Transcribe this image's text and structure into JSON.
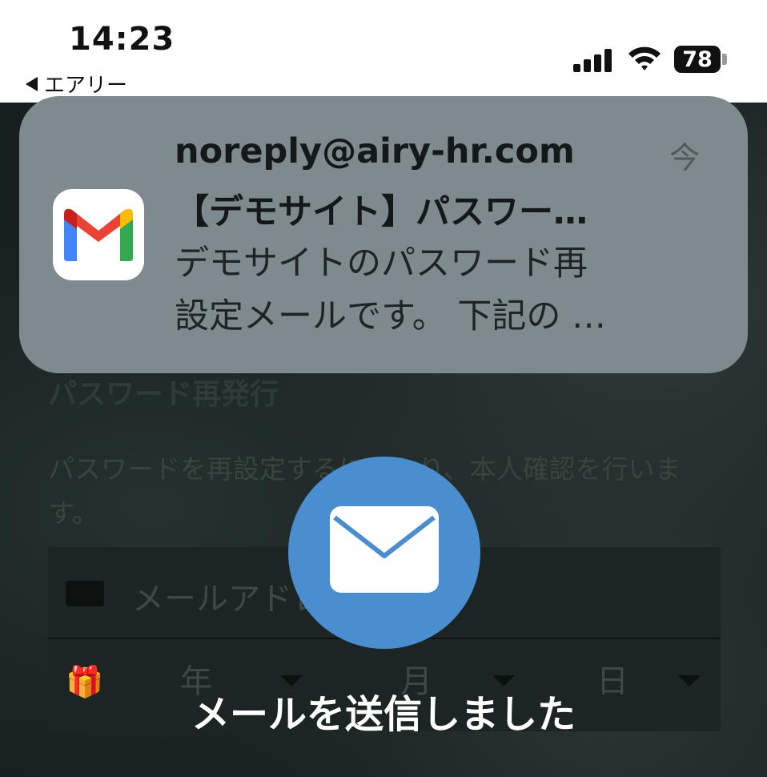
{
  "status_bar": {
    "time": "14:23",
    "back_app": "エアリー",
    "battery": "78"
  },
  "background_page": {
    "heading": "パスワード再発行",
    "description": "パスワードを再設定するにあたり、本人確認を行います。",
    "email_placeholder": "メールアドレス",
    "year_label": "年",
    "month_label": "月",
    "day_label": "日"
  },
  "notification": {
    "app_icon": "gmail-icon",
    "sender": "noreply@airy-hr.com",
    "time": "今",
    "subject": "【デモサイト】パスワー…",
    "body_line1": "デモサイトのパスワード再",
    "body_line2": "設定メールです。 下記の …"
  },
  "toast": {
    "icon": "envelope-icon",
    "message": "メールを送信しました",
    "accent": "#4a8ecf"
  }
}
